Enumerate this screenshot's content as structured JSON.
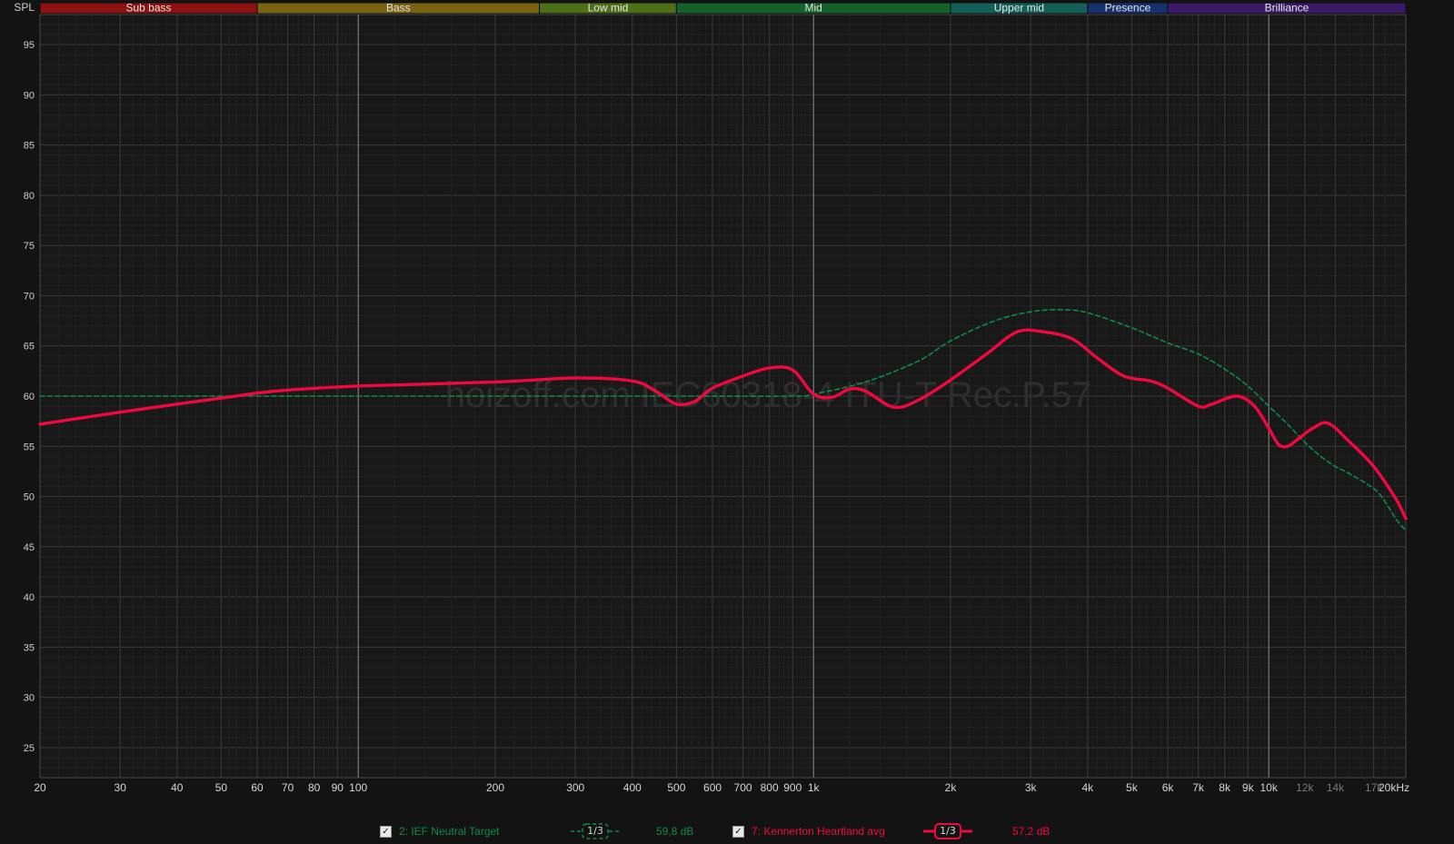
{
  "chart_data": {
    "type": "line",
    "ylabel": "SPL",
    "xlabel_unit": "Hz",
    "x_scale": "log",
    "xlim": [
      20,
      20000
    ],
    "ylim": [
      22,
      98
    ],
    "grid": true,
    "watermark": "hoizoff.com IEC60318-4 ITU-T Rec.P.57",
    "y_ticks": [
      25,
      30,
      35,
      40,
      45,
      50,
      55,
      60,
      65,
      70,
      75,
      80,
      85,
      90,
      95
    ],
    "x_ticks": [
      {
        "f": 20,
        "label": "20"
      },
      {
        "f": 30,
        "label": "30"
      },
      {
        "f": 40,
        "label": "40"
      },
      {
        "f": 50,
        "label": "50"
      },
      {
        "f": 60,
        "label": "60"
      },
      {
        "f": 70,
        "label": "70"
      },
      {
        "f": 80,
        "label": "80"
      },
      {
        "f": 90,
        "label": "90"
      },
      {
        "f": 100,
        "label": "100"
      },
      {
        "f": 200,
        "label": "200"
      },
      {
        "f": 300,
        "label": "300"
      },
      {
        "f": 400,
        "label": "400"
      },
      {
        "f": 500,
        "label": "500"
      },
      {
        "f": 600,
        "label": "600"
      },
      {
        "f": 700,
        "label": "700"
      },
      {
        "f": 800,
        "label": "800"
      },
      {
        "f": 900,
        "label": "900"
      },
      {
        "f": 1000,
        "label": "1k"
      },
      {
        "f": 2000,
        "label": "2k"
      },
      {
        "f": 3000,
        "label": "3k"
      },
      {
        "f": 4000,
        "label": "4k"
      },
      {
        "f": 5000,
        "label": "5k"
      },
      {
        "f": 6000,
        "label": "6k"
      },
      {
        "f": 7000,
        "label": "7k"
      },
      {
        "f": 8000,
        "label": "8k"
      },
      {
        "f": 9000,
        "label": "9k"
      },
      {
        "f": 10000,
        "label": "10k"
      },
      {
        "f": 12000,
        "label": "12k",
        "dim": true
      },
      {
        "f": 14000,
        "label": "14k",
        "dim": true
      },
      {
        "f": 17000,
        "label": "17k",
        "dim": true
      },
      {
        "f": 20000,
        "label": "20kHz"
      }
    ],
    "bands": [
      {
        "name": "Sub bass",
        "from": 20,
        "to": 60,
        "color": "#8c1111"
      },
      {
        "name": "Bass",
        "from": 60,
        "to": 250,
        "color": "#7a6312"
      },
      {
        "name": "Low mid",
        "from": 250,
        "to": 500,
        "color": "#4d6f18"
      },
      {
        "name": "Mid",
        "from": 500,
        "to": 2000,
        "color": "#14612a"
      },
      {
        "name": "Upper mid",
        "from": 2000,
        "to": 4000,
        "color": "#145f58"
      },
      {
        "name": "Presence",
        "from": 4000,
        "to": 6000,
        "color": "#17306e"
      },
      {
        "name": "Brilliance",
        "from": 6000,
        "to": 20000,
        "color": "#3a1a66"
      }
    ],
    "series": [
      {
        "name": "2: IEF Neutral Target",
        "color": "#0f8a4a",
        "style": "dashed",
        "smoothing": "1/3",
        "level": "59,8 dB",
        "points": [
          [
            20,
            60
          ],
          [
            100,
            60
          ],
          [
            500,
            60
          ],
          [
            900,
            60
          ],
          [
            1000,
            60.2
          ],
          [
            1300,
            61.4
          ],
          [
            1700,
            63.5
          ],
          [
            2000,
            65.5
          ],
          [
            2500,
            67.5
          ],
          [
            3000,
            68.4
          ],
          [
            3500,
            68.6
          ],
          [
            4000,
            68.3
          ],
          [
            5000,
            66.8
          ],
          [
            6000,
            65.3
          ],
          [
            7000,
            64.2
          ],
          [
            8000,
            62.7
          ],
          [
            9000,
            61
          ],
          [
            10000,
            59
          ],
          [
            11000,
            57.2
          ],
          [
            12000,
            55.4
          ],
          [
            13000,
            54
          ],
          [
            14000,
            53
          ],
          [
            15000,
            52.3
          ],
          [
            17000,
            50.8
          ],
          [
            18000,
            49.5
          ],
          [
            19000,
            47.8
          ],
          [
            20000,
            46.6
          ]
        ]
      },
      {
        "name": "7: Kennerton Heartland avg",
        "color": "#f0093f",
        "style": "solid",
        "smoothing": "1/3",
        "level": "57,2 dB",
        "points": [
          [
            20,
            57.2
          ],
          [
            30,
            58.4
          ],
          [
            40,
            59.2
          ],
          [
            50,
            59.8
          ],
          [
            60,
            60.3
          ],
          [
            70,
            60.6
          ],
          [
            100,
            61
          ],
          [
            200,
            61.4
          ],
          [
            300,
            61.8
          ],
          [
            400,
            61.5
          ],
          [
            450,
            60.5
          ],
          [
            500,
            59.2
          ],
          [
            550,
            59.5
          ],
          [
            600,
            60.8
          ],
          [
            700,
            62
          ],
          [
            800,
            62.8
          ],
          [
            900,
            62.6
          ],
          [
            1000,
            60.2
          ],
          [
            1100,
            59.9
          ],
          [
            1200,
            60.7
          ],
          [
            1300,
            60.5
          ],
          [
            1500,
            58.9
          ],
          [
            1700,
            59.6
          ],
          [
            2000,
            61.6
          ],
          [
            2400,
            64.2
          ],
          [
            2800,
            66.4
          ],
          [
            3200,
            66.4
          ],
          [
            3700,
            65.7
          ],
          [
            4200,
            63.8
          ],
          [
            4800,
            62
          ],
          [
            5500,
            61.5
          ],
          [
            6000,
            60.8
          ],
          [
            7000,
            59
          ],
          [
            7500,
            59.2
          ],
          [
            8500,
            60
          ],
          [
            9300,
            59
          ],
          [
            10000,
            56.8
          ],
          [
            10500,
            55.2
          ],
          [
            11000,
            55
          ],
          [
            11500,
            55.6
          ],
          [
            12500,
            56.8
          ],
          [
            13500,
            57.3
          ],
          [
            15000,
            55.5
          ],
          [
            17000,
            53
          ],
          [
            19000,
            49.8
          ],
          [
            20000,
            47.8
          ]
        ]
      }
    ]
  },
  "legend": {
    "target_check": "✓",
    "target_name": "2: IEF Neutral Target",
    "target_smoothing": "1/3",
    "target_level": "59,8 dB",
    "measurement_check": "✓",
    "measurement_name": "7: Kennerton Heartland avg",
    "measurement_smoothing": "1/3",
    "measurement_level": "57,2 dB"
  }
}
